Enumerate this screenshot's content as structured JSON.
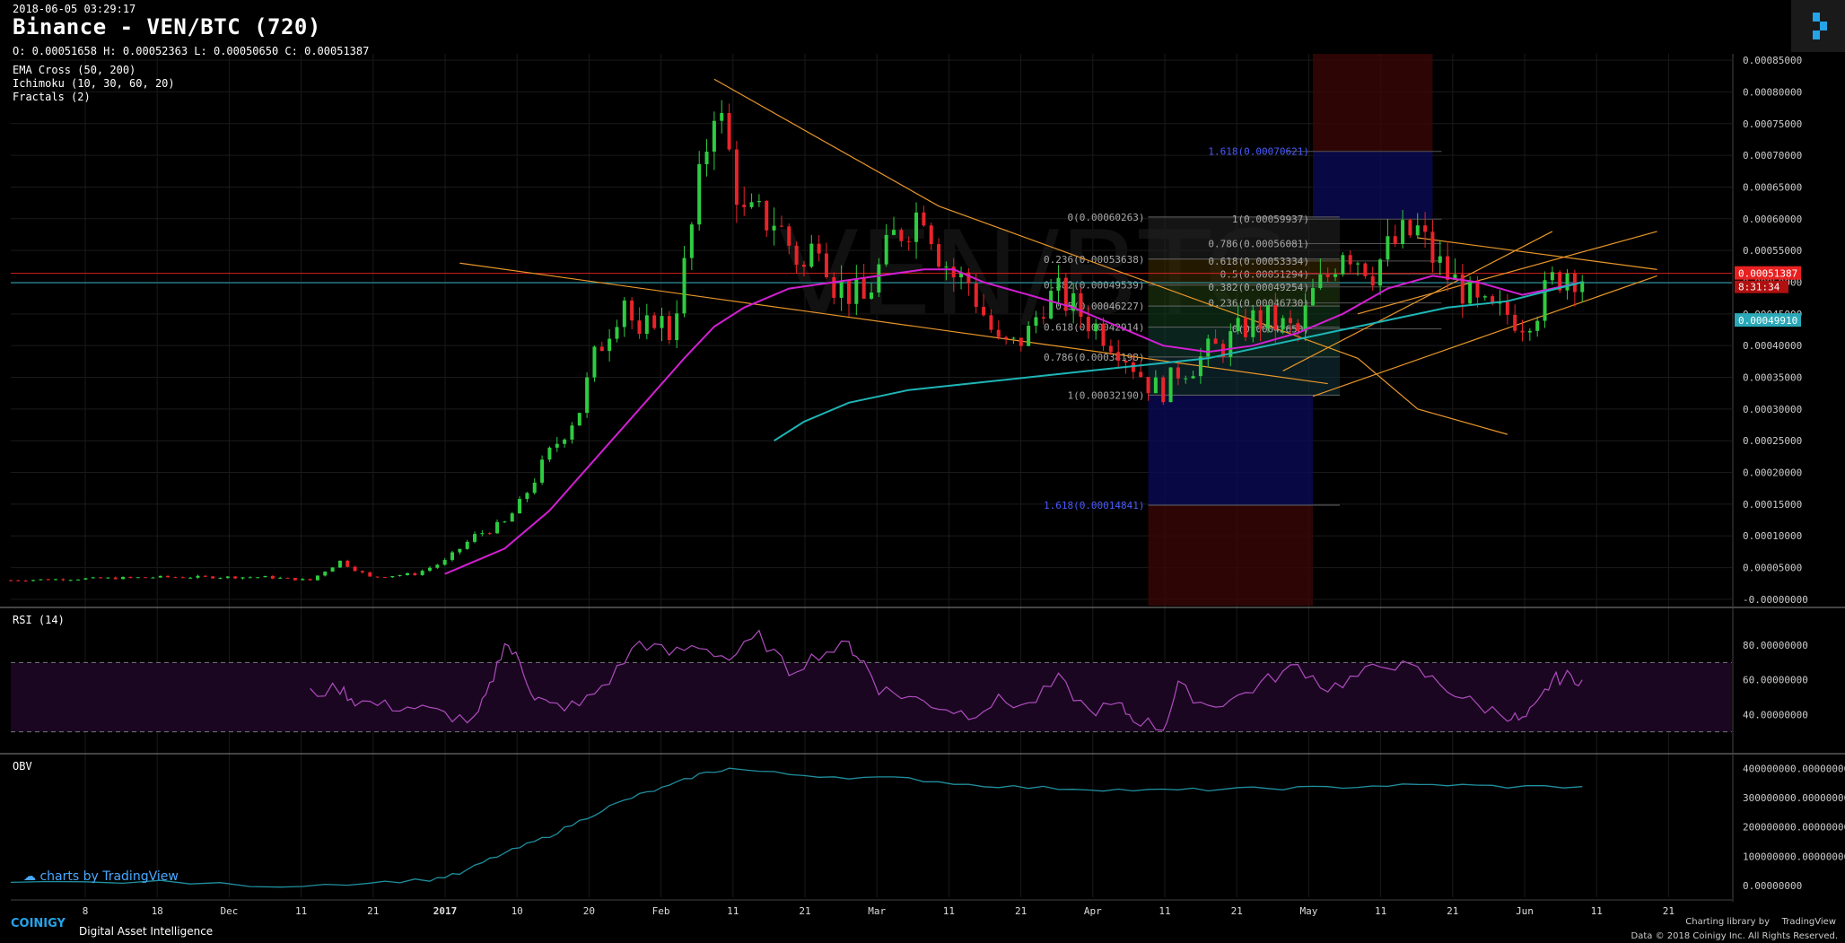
{
  "header": {
    "datetime": "2018-06-05 03:29:17",
    "title": "Binance - VEN/BTC (720)",
    "ohlc": "O: 0.00051658 H: 0.00052363 L: 0.00050650 C: 0.00051387"
  },
  "indicators": [
    "EMA Cross (50, 200)",
    "Ichimoku (10, 30, 60, 20)",
    "Fractals (2)"
  ],
  "watermark": "VEN/BTC",
  "panels": {
    "rsi_label": "RSI (14)",
    "obv_label": "OBV"
  },
  "branding": {
    "tradingview": "charts by TradingView",
    "coinigy": "COINIGY",
    "coinigy_tagline": "Digital Asset Intelligence",
    "charting_library": "Charting library by",
    "tradingview_brand": "TradingView",
    "copyright": "Data © 2018 Coinigy Inc. All Rights Reserved."
  },
  "colors": {
    "background": "#000000",
    "up": "#2ecc40",
    "down": "#e8242a",
    "ema50": "#d21fd2",
    "ema200": "#1eb5b5",
    "trendline": "#e8962a",
    "rsi": "#b04cc0",
    "obv": "#1f8f9e",
    "grid": "#1a1a1a"
  },
  "chart_data": {
    "type": "candlestick",
    "symbol": "VEN/BTC",
    "exchange": "Binance",
    "interval": "720",
    "x_ticks": [
      "8",
      "18",
      "Dec",
      "11",
      "21",
      "2017",
      "10",
      "20",
      "Feb",
      "11",
      "21",
      "Mar",
      "11",
      "21",
      "Apr",
      "11",
      "21",
      "May",
      "11",
      "21",
      "Jun",
      "11",
      "21"
    ],
    "y_ticks": [
      "0.00085000",
      "0.00080000",
      "0.00075000",
      "0.00070000",
      "0.00065000",
      "0.00060000",
      "0.00055000",
      "0.00050000",
      "0.00045000",
      "0.00040000",
      "0.00035000",
      "0.00030000",
      "0.00025000",
      "0.00020000",
      "0.00015000",
      "0.00010000",
      "0.00005000",
      "-0.00000000"
    ],
    "ylim": [
      -1e-05,
      0.00086
    ],
    "last_price": "0.00051387",
    "countdown": "8:31:34",
    "ema200_value": "0.00049910",
    "price_path": [
      [
        0,
        3e-05
      ],
      [
        10,
        3.5e-05
      ],
      [
        17,
        3.5e-05
      ],
      [
        20,
        3e-05
      ],
      [
        22,
        6e-05
      ],
      [
        24,
        3.5e-05
      ],
      [
        27,
        4e-05
      ],
      [
        29,
        6e-05
      ],
      [
        31,
        0.0001
      ],
      [
        33,
        0.00012
      ],
      [
        34,
        0.00015
      ],
      [
        36,
        0.00023
      ],
      [
        38,
        0.0003
      ],
      [
        39,
        0.00038
      ],
      [
        41,
        0.00048
      ],
      [
        42,
        0.0004
      ],
      [
        43,
        0.00045
      ],
      [
        44,
        0.00042
      ],
      [
        45,
        0.00052
      ],
      [
        46,
        0.00065
      ],
      [
        47,
        0.00079
      ],
      [
        48,
        0.0007
      ],
      [
        49,
        0.0006
      ],
      [
        51,
        0.0006
      ],
      [
        52,
        0.00056
      ],
      [
        53,
        0.00052
      ],
      [
        54,
        0.00058
      ],
      [
        55,
        0.0005
      ],
      [
        57,
        0.00047
      ],
      [
        59,
        0.00057
      ],
      [
        61,
        0.00062
      ],
      [
        62,
        0.00055
      ],
      [
        63,
        0.00051
      ],
      [
        64,
        0.0005
      ],
      [
        65,
        0.00045
      ],
      [
        66,
        0.0004
      ],
      [
        67,
        0.0004
      ],
      [
        68,
        0.00042
      ],
      [
        69,
        0.00047
      ],
      [
        70,
        0.00048
      ],
      [
        71,
        0.00046
      ],
      [
        72,
        0.00044
      ],
      [
        73,
        0.00042
      ],
      [
        74,
        0.0004
      ],
      [
        75,
        0.00037
      ],
      [
        76,
        0.00034
      ],
      [
        77,
        0.00033
      ],
      [
        78,
        0.00036
      ],
      [
        79,
        0.00037
      ],
      [
        80,
        0.00039
      ],
      [
        81,
        0.0004
      ],
      [
        82,
        0.00042
      ],
      [
        83,
        0.00044
      ],
      [
        84,
        0.00044
      ],
      [
        85,
        0.00043
      ],
      [
        86,
        0.00042
      ],
      [
        87,
        0.00048
      ],
      [
        88,
        0.00051
      ],
      [
        89,
        0.00056
      ],
      [
        90,
        0.00054
      ],
      [
        91,
        0.00052
      ],
      [
        92,
        0.00055
      ],
      [
        93,
        0.00057
      ],
      [
        94,
        0.00058
      ],
      [
        95,
        0.00054
      ],
      [
        96,
        0.00051
      ],
      [
        97,
        0.00049
      ],
      [
        98,
        0.00046
      ],
      [
        99,
        0.00045
      ],
      [
        100,
        0.00045
      ],
      [
        101,
        0.00044
      ],
      [
        102,
        0.00046
      ],
      [
        103,
        0.0005
      ],
      [
        104,
        0.00052
      ],
      [
        105,
        0.00051
      ]
    ],
    "ema50": [
      [
        29,
        4e-05
      ],
      [
        33,
        8e-05
      ],
      [
        36,
        0.00014
      ],
      [
        39,
        0.00022
      ],
      [
        42,
        0.0003
      ],
      [
        45,
        0.00038
      ],
      [
        47,
        0.00043
      ],
      [
        49,
        0.00046
      ],
      [
        52,
        0.00049
      ],
      [
        55,
        0.0005
      ],
      [
        58,
        0.00051
      ],
      [
        61,
        0.00052
      ],
      [
        63,
        0.00052
      ],
      [
        65,
        0.0005
      ],
      [
        68,
        0.00048
      ],
      [
        71,
        0.00046
      ],
      [
        74,
        0.00043
      ],
      [
        77,
        0.0004
      ],
      [
        80,
        0.00039
      ],
      [
        83,
        0.0004
      ],
      [
        86,
        0.00042
      ],
      [
        89,
        0.00045
      ],
      [
        92,
        0.00049
      ],
      [
        95,
        0.00051
      ],
      [
        98,
        0.0005
      ],
      [
        101,
        0.00048
      ],
      [
        103,
        0.00049
      ],
      [
        105,
        0.0005
      ]
    ],
    "ema200": [
      [
        51,
        0.00025
      ],
      [
        53,
        0.00028
      ],
      [
        56,
        0.00031
      ],
      [
        60,
        0.00033
      ],
      [
        64,
        0.00034
      ],
      [
        68,
        0.00035
      ],
      [
        72,
        0.00036
      ],
      [
        76,
        0.00037
      ],
      [
        80,
        0.00038
      ],
      [
        84,
        0.0004
      ],
      [
        88,
        0.00042
      ],
      [
        92,
        0.00044
      ],
      [
        96,
        0.00046
      ],
      [
        100,
        0.00047
      ],
      [
        105,
        0.0005
      ]
    ],
    "fib_left": [
      {
        "label": "0(0.00060263)",
        "value": 0.00060263
      },
      {
        "label": "0.236(0.00053638)",
        "value": 0.00053638
      },
      {
        "label": "0.382(0.00049539)",
        "value": 0.00049539
      },
      {
        "label": "0.5(0.00046227)",
        "value": 0.00046227
      },
      {
        "label": "0.618(0.00042914)",
        "value": 0.00042914
      },
      {
        "label": "0.786(0.00038198)",
        "value": 0.00038198
      },
      {
        "label": "1(0.00032190)",
        "value": 0.0003219
      },
      {
        "label": "1.618(0.00014841)",
        "value": 0.00014841
      }
    ],
    "fib_right": [
      {
        "label": "1.618(0.00070621)",
        "value": 0.00070621
      },
      {
        "label": "1(0.00059937)",
        "value": 0.00059937
      },
      {
        "label": "0.786(0.00056081)",
        "value": 0.00056081
      },
      {
        "label": "0.618(0.00053334)",
        "value": 0.00053334
      },
      {
        "label": "0.5(0.00051294)",
        "value": 0.00051294
      },
      {
        "label": "0.382(0.00049254)",
        "value": 0.00049254
      },
      {
        "label": "0.236(0.00046730)",
        "value": 0.0004673
      },
      {
        "label": "0(0.00042650)",
        "value": 0.0004265
      }
    ],
    "rsi": {
      "y_ticks": [
        "80.00000000",
        "60.00000000",
        "40.00000000"
      ],
      "ylim": [
        20,
        95
      ],
      "band": [
        30,
        70
      ],
      "values": [
        [
          20,
          52
        ],
        [
          22,
          55
        ],
        [
          23,
          48
        ],
        [
          25,
          45
        ],
        [
          27,
          44
        ],
        [
          29,
          40
        ],
        [
          31,
          36
        ],
        [
          32,
          55
        ],
        [
          33,
          82
        ],
        [
          34,
          70
        ],
        [
          35,
          50
        ],
        [
          36,
          45
        ],
        [
          38,
          45
        ],
        [
          40,
          60
        ],
        [
          42,
          82
        ],
        [
          44,
          75
        ],
        [
          46,
          80
        ],
        [
          48,
          72
        ],
        [
          50,
          85
        ],
        [
          52,
          65
        ],
        [
          54,
          75
        ],
        [
          56,
          80
        ],
        [
          57,
          70
        ],
        [
          58,
          55
        ],
        [
          60,
          50
        ],
        [
          62,
          45
        ],
        [
          64,
          40
        ],
        [
          66,
          48
        ],
        [
          68,
          45
        ],
        [
          70,
          60
        ],
        [
          72,
          42
        ],
        [
          74,
          45
        ],
        [
          75,
          38
        ],
        [
          77,
          32
        ],
        [
          78,
          56
        ],
        [
          80,
          45
        ],
        [
          82,
          50
        ],
        [
          84,
          60
        ],
        [
          86,
          68
        ],
        [
          88,
          55
        ],
        [
          90,
          62
        ],
        [
          92,
          70
        ],
        [
          94,
          65
        ],
        [
          96,
          55
        ],
        [
          98,
          45
        ],
        [
          100,
          40
        ],
        [
          101,
          36
        ],
        [
          102,
          45
        ],
        [
          103,
          60
        ],
        [
          104,
          62
        ],
        [
          105,
          60
        ]
      ]
    },
    "obv": {
      "y_ticks": [
        "400000000.00000000",
        "300000000.00000000",
        "200000000.00000000",
        "100000000.00000000",
        "0.00000000"
      ],
      "ylim": [
        -40000000,
        420000000
      ],
      "values": [
        [
          0,
          10000000
        ],
        [
          10,
          12000000
        ],
        [
          18,
          -2000000
        ],
        [
          24,
          10000000
        ],
        [
          28,
          20000000
        ],
        [
          30,
          40000000
        ],
        [
          32,
          90000000
        ],
        [
          34,
          130000000
        ],
        [
          36,
          170000000
        ],
        [
          38,
          220000000
        ],
        [
          40,
          270000000
        ],
        [
          42,
          310000000
        ],
        [
          44,
          340000000
        ],
        [
          46,
          380000000
        ],
        [
          48,
          400000000
        ],
        [
          52,
          380000000
        ],
        [
          56,
          370000000
        ],
        [
          60,
          365000000
        ],
        [
          64,
          345000000
        ],
        [
          68,
          335000000
        ],
        [
          72,
          330000000
        ],
        [
          76,
          325000000
        ],
        [
          80,
          328000000
        ],
        [
          84,
          332000000
        ],
        [
          88,
          335000000
        ],
        [
          92,
          342000000
        ],
        [
          96,
          344000000
        ],
        [
          100,
          338000000
        ],
        [
          105,
          338000000
        ]
      ]
    }
  }
}
